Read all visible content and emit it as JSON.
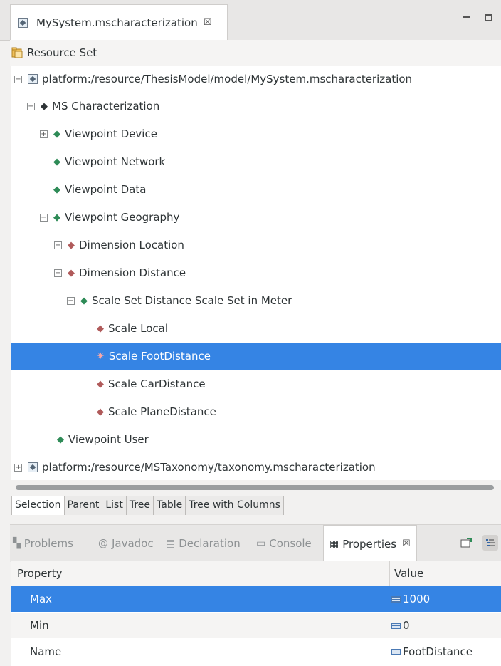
{
  "editor": {
    "tab_title": "MySystem.mscharacterization",
    "tab_close": "☒"
  },
  "resource_set": {
    "label": "Resource Set"
  },
  "tree": {
    "rows": [
      {
        "label": "platform:/resource/ThesisModel/model/MySystem.mscharacterization",
        "expander": "−",
        "icon": "file"
      },
      {
        "label": "MS Characterization",
        "expander": "−",
        "icon": "◆"
      },
      {
        "label": "Viewpoint Device",
        "expander": "+",
        "icon": "◆"
      },
      {
        "label": "Viewpoint Network",
        "icon": "◆"
      },
      {
        "label": "Viewpoint Data",
        "icon": "◆"
      },
      {
        "label": "Viewpoint Geography",
        "expander": "−",
        "icon": "◆"
      },
      {
        "label": "Dimension Location",
        "expander": "+",
        "icon": "◆"
      },
      {
        "label": "Dimension Distance",
        "expander": "−",
        "icon": "◆"
      },
      {
        "label": "Scale Set Distance Scale Set in Meter",
        "expander": "−",
        "icon": "◆"
      },
      {
        "label": "Scale Local",
        "icon": "◆"
      },
      {
        "label": "Scale FootDistance",
        "icon": "✷",
        "selected": true
      },
      {
        "label": "Scale CarDistance",
        "icon": "◆"
      },
      {
        "label": "Scale PlaneDistance",
        "icon": "◆"
      },
      {
        "label": "Viewpoint User",
        "icon": "◆"
      },
      {
        "label": "platform:/resource/MSTaxonomy/taxonomy.mscharacterization",
        "expander": "+",
        "icon": "file"
      }
    ]
  },
  "view_tabs": [
    "Selection",
    "Parent",
    "List",
    "Tree",
    "Table",
    "Tree with Columns"
  ],
  "bottom_tabs": {
    "problems": "Problems",
    "javadoc": "Javadoc",
    "declaration": "Declaration",
    "console": "Console",
    "properties": "Properties",
    "close": "☒"
  },
  "properties": {
    "header_property": "Property",
    "header_value": "Value",
    "rows": [
      {
        "name": "Max",
        "value": "1000",
        "selected": true
      },
      {
        "name": "Min",
        "value": "0"
      },
      {
        "name": "Name",
        "value": "FootDistance"
      }
    ]
  },
  "colors": {
    "selection": "#3584e4",
    "green_node": "#2e8b57",
    "mauve_node": "#b05a5a"
  }
}
